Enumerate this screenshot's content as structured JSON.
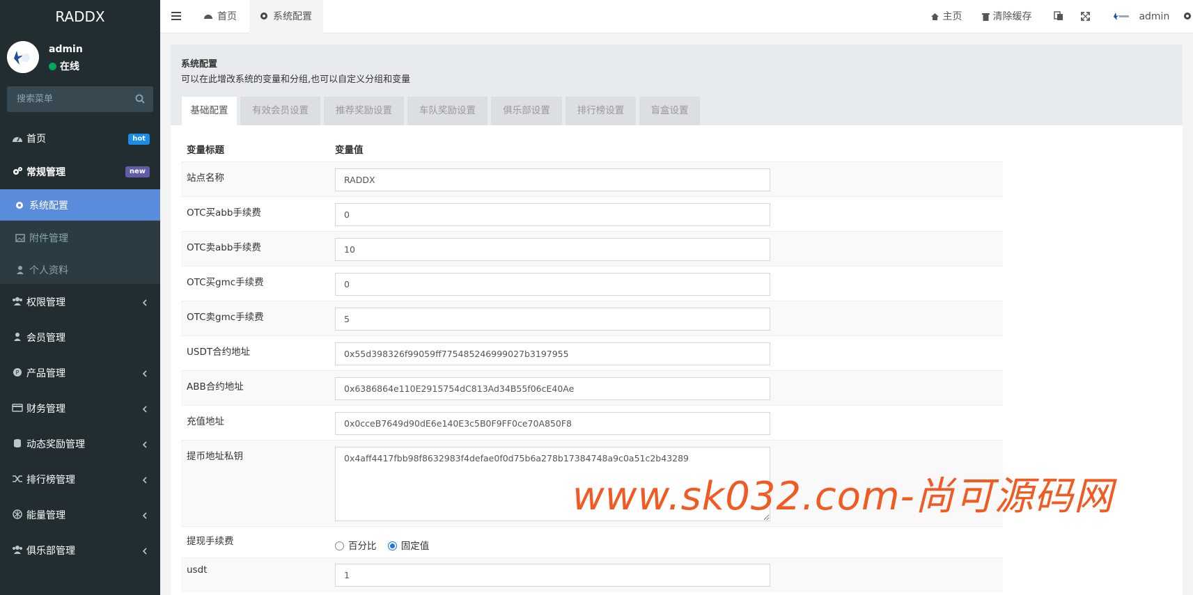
{
  "app": {
    "brand": "RADDX"
  },
  "user": {
    "name": "admin",
    "status": "在线"
  },
  "search": {
    "placeholder": "搜索菜单"
  },
  "sidebar": {
    "items": [
      {
        "label": "首页",
        "badge": "hot"
      },
      {
        "label": "常规管理",
        "badge": "new"
      },
      {
        "label": "系统配置"
      },
      {
        "label": "附件管理"
      },
      {
        "label": "个人资料"
      },
      {
        "label": "权限管理"
      },
      {
        "label": "会员管理"
      },
      {
        "label": "产品管理"
      },
      {
        "label": "财务管理"
      },
      {
        "label": "动态奖励管理"
      },
      {
        "label": "排行榜管理"
      },
      {
        "label": "能量管理"
      },
      {
        "label": "俱乐部管理"
      }
    ]
  },
  "header": {
    "tabs": [
      {
        "label": "首页"
      },
      {
        "label": "系统配置"
      }
    ],
    "home": "主页",
    "clear_cache": "清除缓存",
    "user": "admin"
  },
  "panel": {
    "title": "系统配置",
    "desc": "可以在此增改系统的变量和分组,也可以自定义分组和变量",
    "tabs": [
      "基础配置",
      "有效会员设置",
      "推荐奖励设置",
      "车队奖励设置",
      "俱乐部设置",
      "排行榜设置",
      "盲盒设置"
    ]
  },
  "table": {
    "col_title": "变量标题",
    "col_value": "变量值",
    "rows": [
      {
        "label": "站点名称",
        "value": "RADDX"
      },
      {
        "label": "OTC买abb手续费",
        "value": "0"
      },
      {
        "label": "OTC卖abb手续费",
        "value": "10"
      },
      {
        "label": "OTC买gmc手续费",
        "value": "0"
      },
      {
        "label": "OTC卖gmc手续费",
        "value": "5"
      },
      {
        "label": "USDT合约地址",
        "value": "0x55d398326f99059ff775485246999027b3197955"
      },
      {
        "label": "ABB合约地址",
        "value": "0x6386864e110E2915754dC813Ad34B55f06cE40Ae"
      },
      {
        "label": "充值地址",
        "value": "0x0cceB7649d90dE6e140E3c5B0F9FF0ce70A850F8"
      },
      {
        "label": "提币地址私钥",
        "value": "0x4aff4417fbb98f8632983f4defae0f0d75b6a278b17384748a9c0a51c2b43289"
      },
      {
        "label": "提现手续费",
        "options": [
          "百分比",
          "固定值"
        ]
      },
      {
        "label": "usdt",
        "value": "1"
      }
    ]
  },
  "watermark": "www.sk032.com-尚可源码网",
  "colors": {
    "sidebar_bg": "#222d32",
    "active_item": "#5b8bdb",
    "watermark": "#f15a22"
  }
}
